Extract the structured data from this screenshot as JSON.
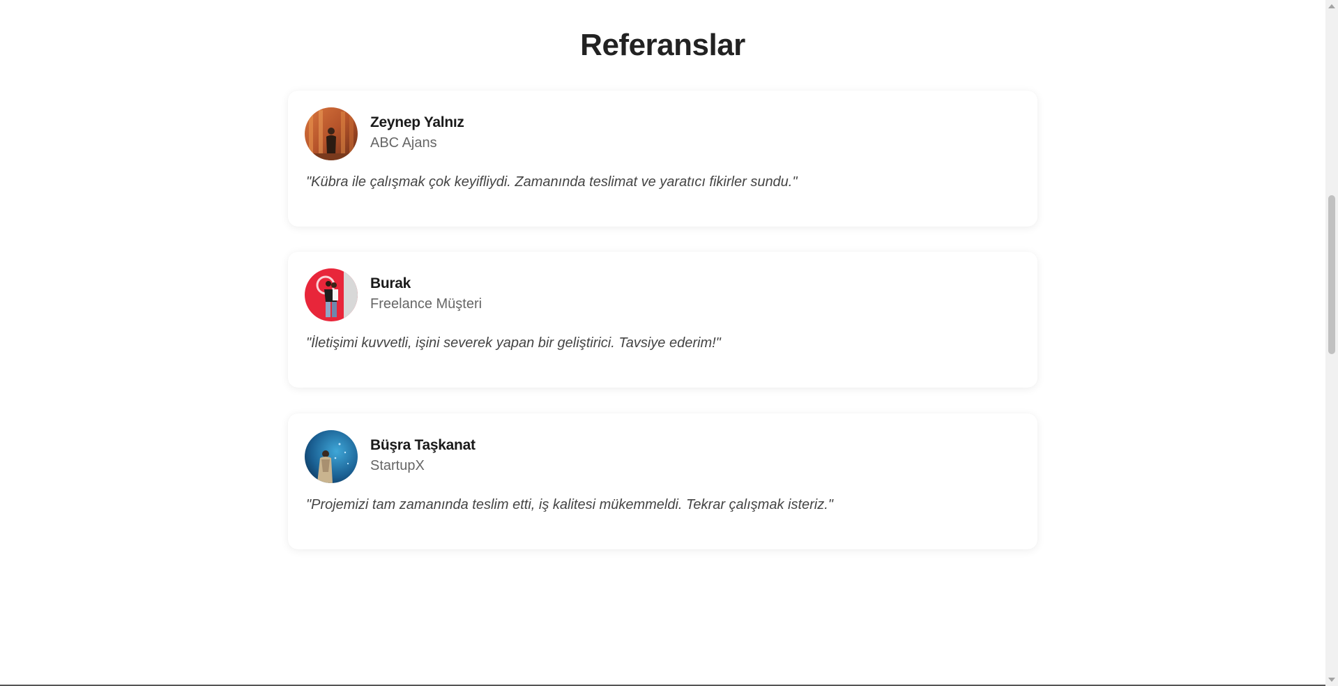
{
  "section": {
    "title": "Referanslar"
  },
  "testimonials": [
    {
      "name": "Zeynep Yalnız",
      "company": "ABC Ajans",
      "quote": "\"Kübra ile çalışmak çok keyifliydi. Zamanında teslimat ve yaratıcı fikirler sundu.\"",
      "avatar": "avatar-photo-woman-columns"
    },
    {
      "name": "Burak",
      "company": "Freelance Müşteri",
      "quote": "\"İletişimi kuvvetli, işini severek yapan bir geliştirici. Tavsiye ederim!\"",
      "avatar": "avatar-photo-couple-red-background"
    },
    {
      "name": "Büşra Taşkanat",
      "company": "StartupX",
      "quote": "\"Projemizi tam zamanında teslim etti, iş kalitesi mükemmeldi. Tekrar çalışmak isteriz.\"",
      "avatar": "avatar-photo-aquarium"
    }
  ],
  "colors": {
    "background": "#ffffff",
    "title": "#222222",
    "name": "#1a1a1a",
    "company": "#666666",
    "quote": "#444444"
  }
}
